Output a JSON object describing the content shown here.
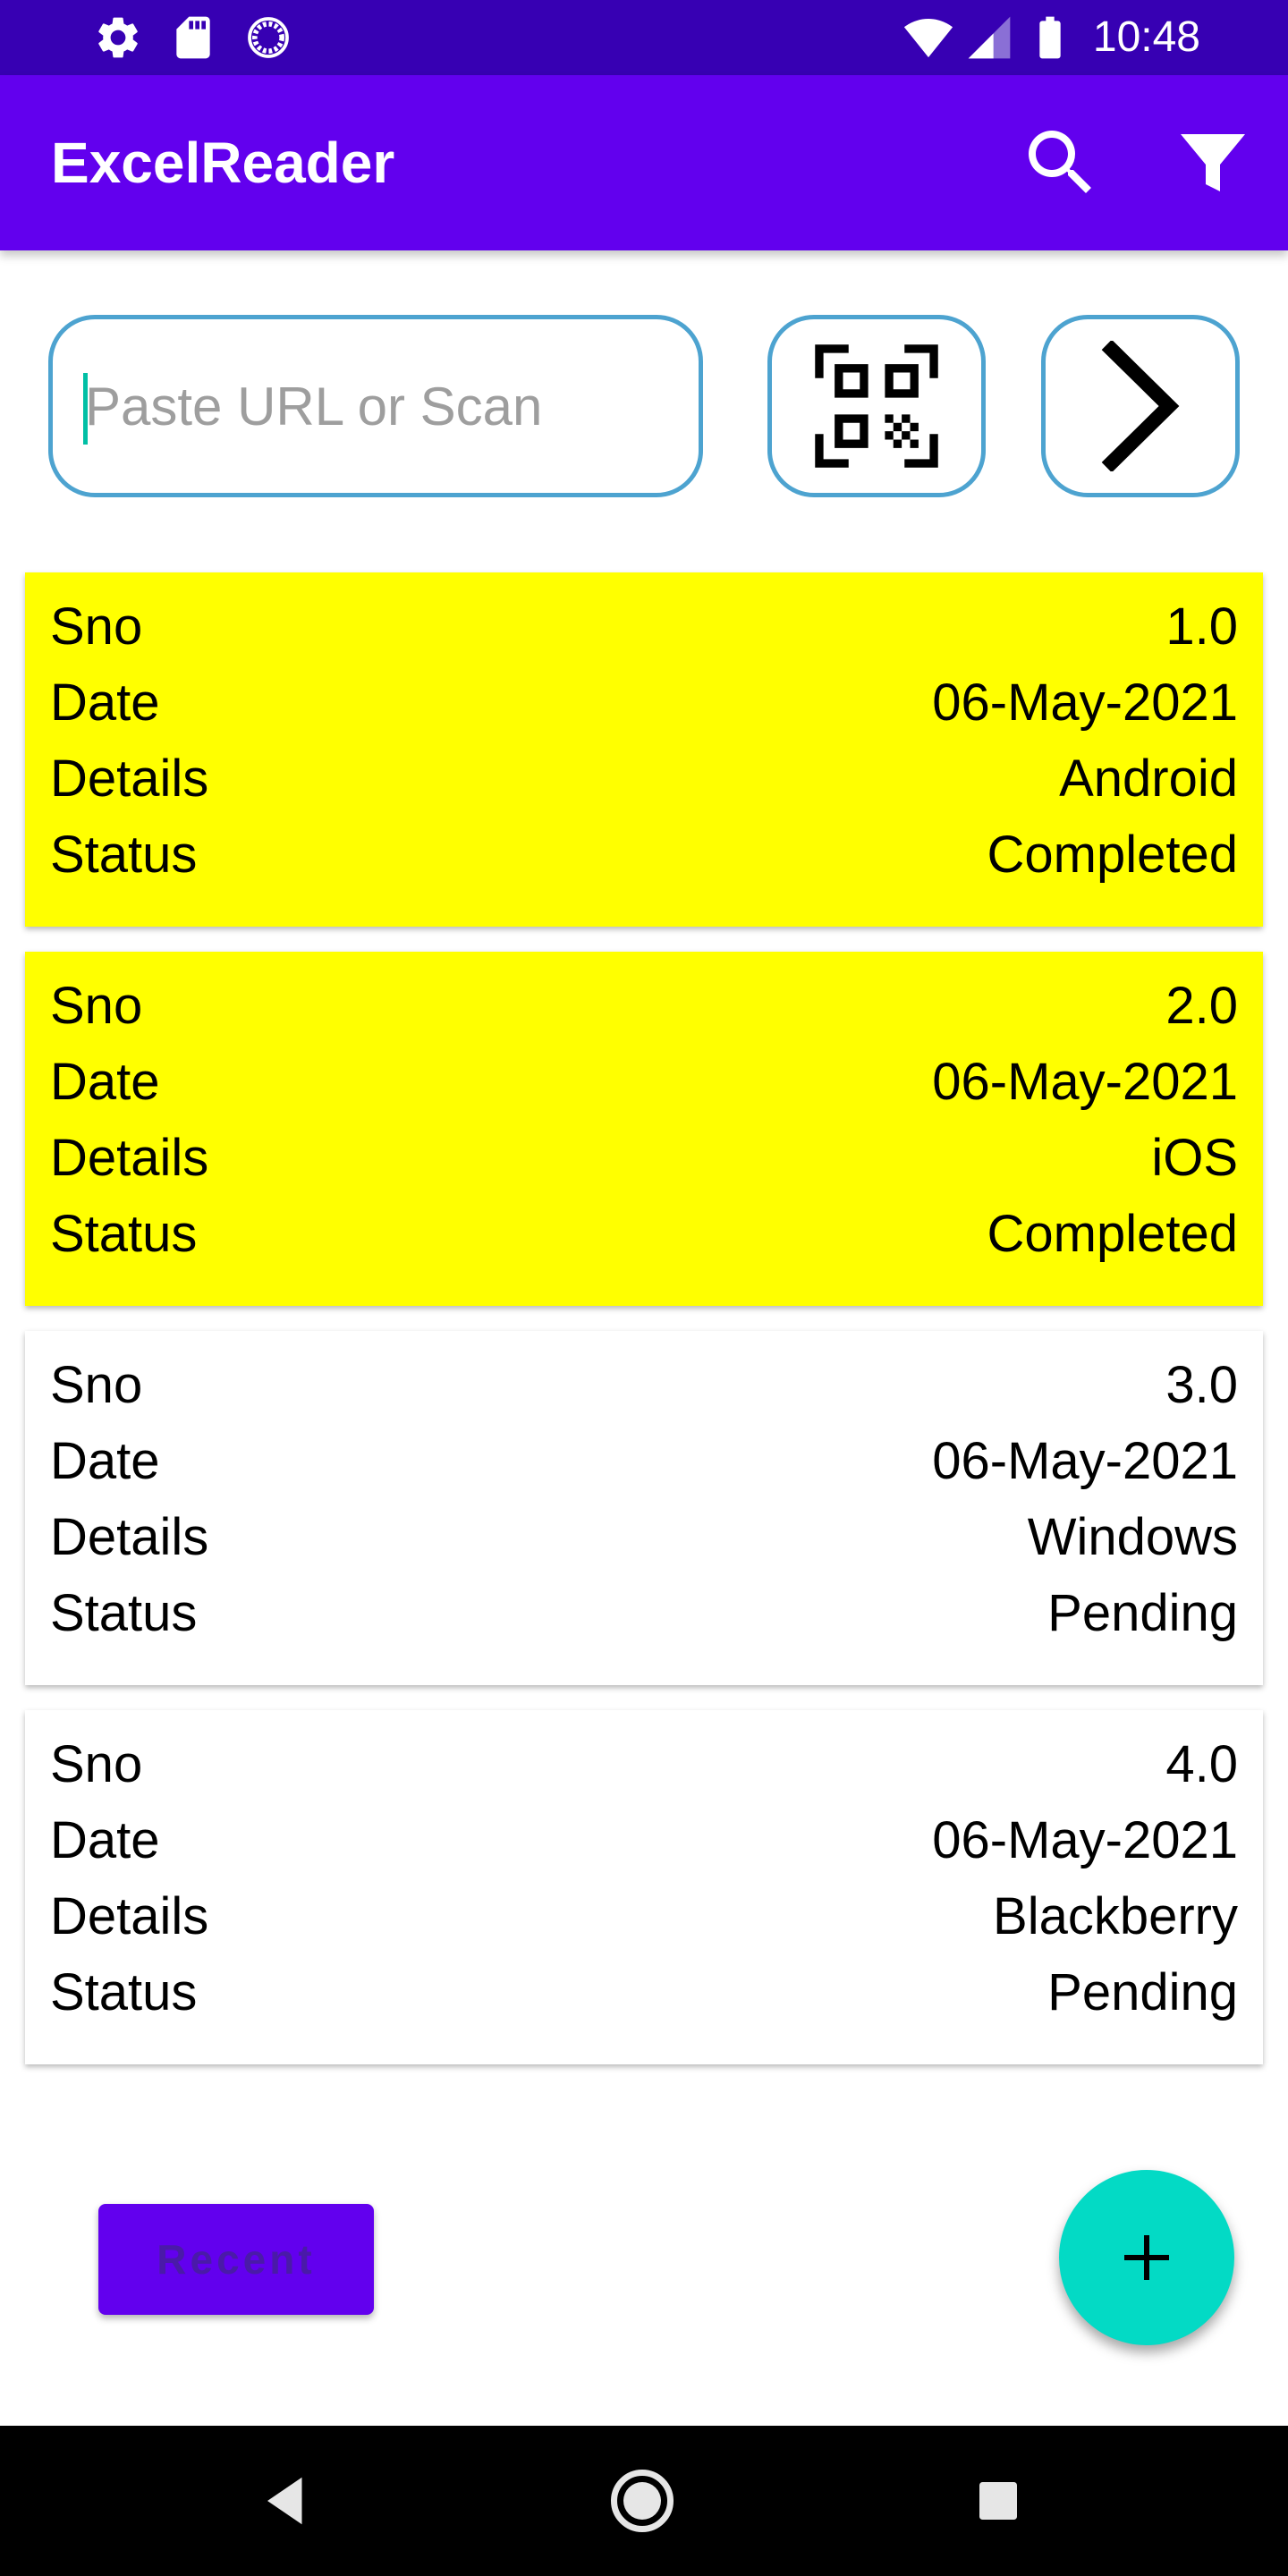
{
  "status_bar": {
    "time": "10:48",
    "left_icons": [
      "gear-icon",
      "sd-card-icon",
      "sync-circle-icon"
    ],
    "right_icons": [
      "wifi-icon",
      "signal-icon",
      "battery-icon"
    ]
  },
  "app_bar": {
    "title": "ExcelReader",
    "actions": [
      "search-icon",
      "filter-icon"
    ]
  },
  "url_input": {
    "placeholder": "Paste URL or Scan",
    "value": ""
  },
  "url_buttons": [
    "qr-code-icon",
    "chevron-right-icon"
  ],
  "records": [
    {
      "highlight": true,
      "fields": [
        {
          "label": "Sno",
          "value": "1.0"
        },
        {
          "label": "Date",
          "value": "06-May-2021"
        },
        {
          "label": "Details",
          "value": "Android"
        },
        {
          "label": "Status",
          "value": "Completed"
        }
      ]
    },
    {
      "highlight": true,
      "fields": [
        {
          "label": "Sno",
          "value": "2.0"
        },
        {
          "label": "Date",
          "value": "06-May-2021"
        },
        {
          "label": "Details",
          "value": "iOS"
        },
        {
          "label": "Status",
          "value": "Completed"
        }
      ]
    },
    {
      "highlight": false,
      "fields": [
        {
          "label": "Sno",
          "value": "3.0"
        },
        {
          "label": "Date",
          "value": "06-May-2021"
        },
        {
          "label": "Details",
          "value": "Windows"
        },
        {
          "label": "Status",
          "value": "Pending"
        }
      ]
    },
    {
      "highlight": false,
      "fields": [
        {
          "label": "Sno",
          "value": "4.0"
        },
        {
          "label": "Date",
          "value": "06-May-2021"
        },
        {
          "label": "Details",
          "value": "Blackberry"
        },
        {
          "label": "Status",
          "value": "Pending"
        }
      ]
    }
  ],
  "recent_button": {
    "label": "Recent"
  },
  "fab": {
    "icon": "plus-icon"
  },
  "nav_bar": {
    "buttons": [
      "back-icon",
      "home-icon",
      "recents-icon"
    ]
  },
  "colors": {
    "status_bar": "#3700B3",
    "app_bar": "#6200EE",
    "accent": "#03DAC5",
    "input_border": "#4DA3D0",
    "completed_card": "#FFFF00",
    "pending_card": "#FFFFFF",
    "nav_bar": "#000000"
  }
}
